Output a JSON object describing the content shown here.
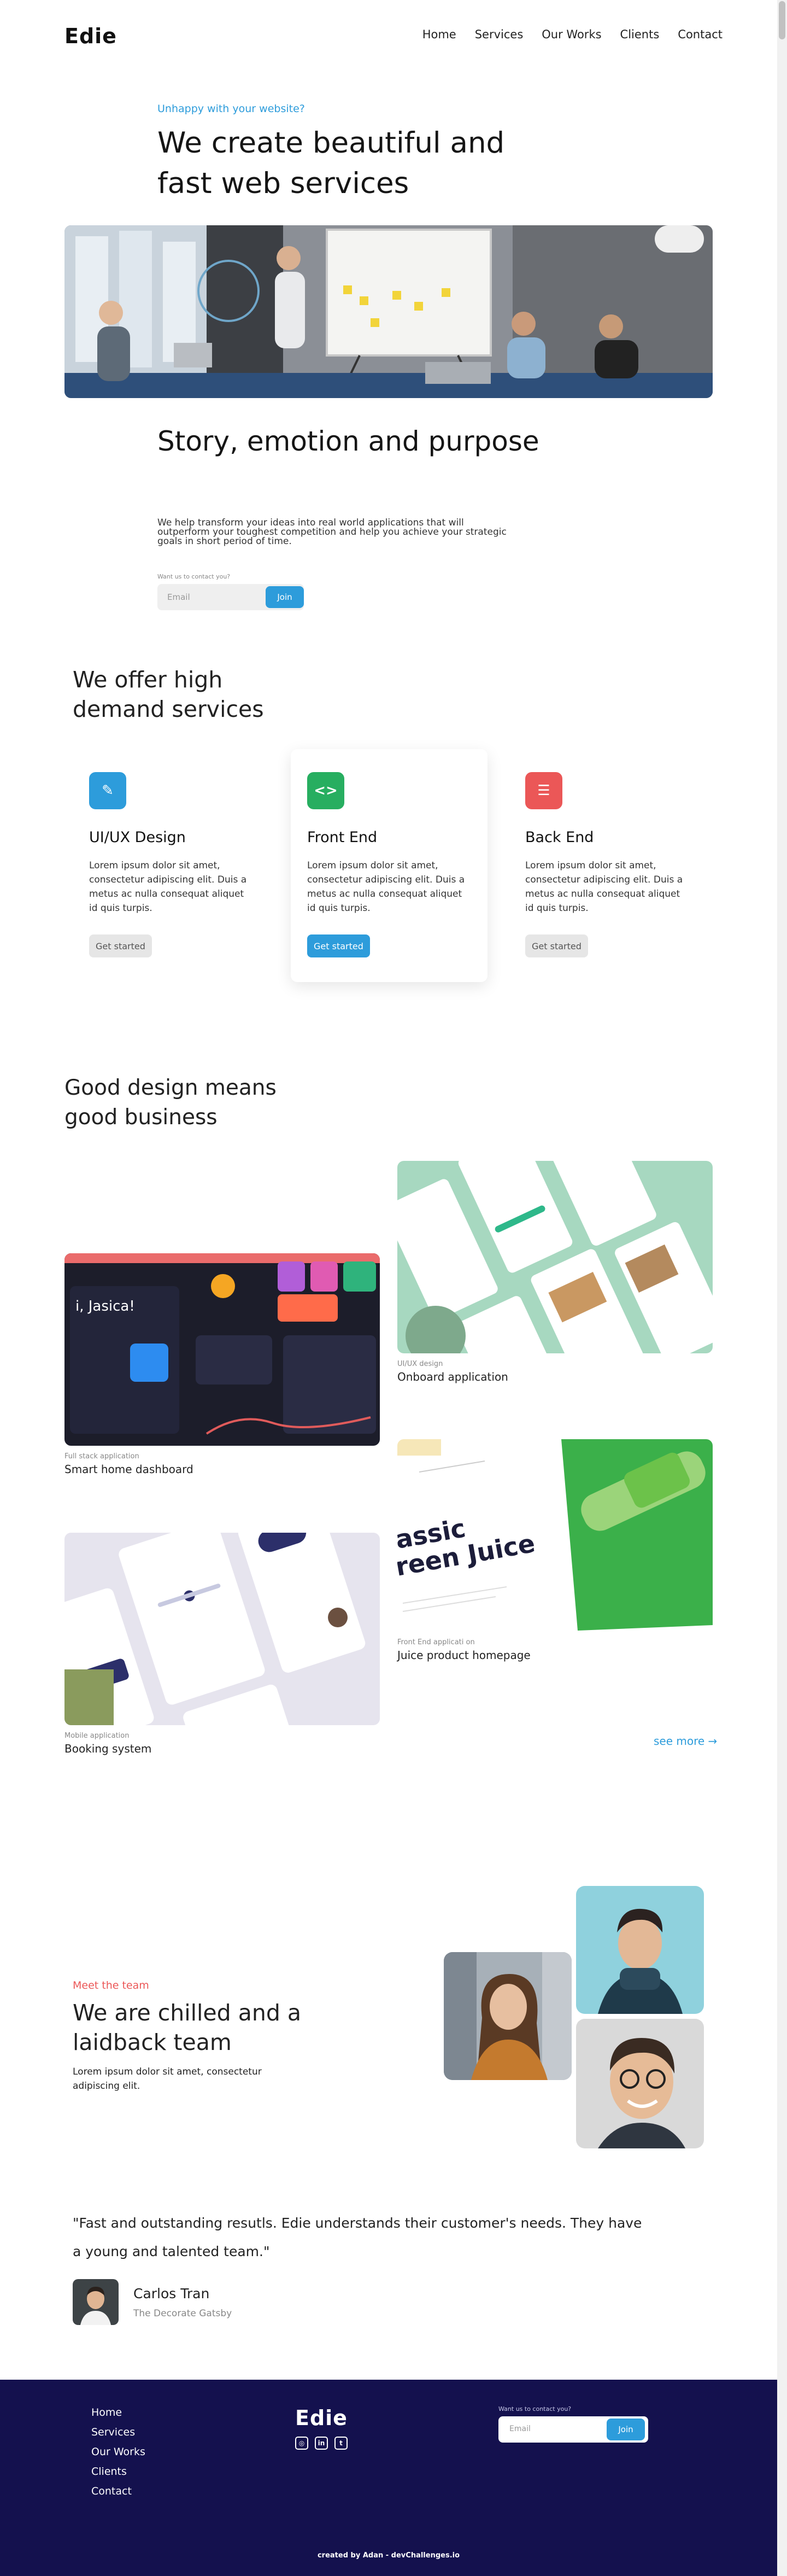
{
  "brand": "Edie",
  "nav": {
    "items": [
      "Home",
      "Services",
      "Our Works",
      "Clients",
      "Contact"
    ]
  },
  "hero": {
    "eyebrow": "Unhappy with your website?",
    "title": "We create beautiful and fast web services",
    "story_title": "Story, emotion and purpose",
    "story_text": "We help transform your ideas into real world applications that will outperform your toughest competition and help you achieve your strategic goals in short period of time.",
    "contact_label": "Want us to contact you?",
    "email_placeholder": "Email",
    "join_label": "Join"
  },
  "services": {
    "title": "We offer high demand services",
    "cards": [
      {
        "title": "UI/UX Design",
        "text": "Lorem ipsum dolor sit amet, consectetur adipiscing elit. Duis a metus ac nulla consequat aliquet id quis turpis.",
        "button": "Get started",
        "icon": "pen-icon",
        "color": "#2d9cdb"
      },
      {
        "title": "Front End",
        "text": "Lorem ipsum dolor sit amet, consectetur adipiscing elit. Duis a metus ac nulla consequat aliquet id quis turpis.",
        "button": "Get started",
        "icon": "code-icon",
        "color": "#27ae60"
      },
      {
        "title": "Back End",
        "text": "Lorem ipsum dolor sit amet, consectetur adipiscing elit. Duis a metus ac nulla consequat aliquet id quis turpis.",
        "button": "Get started",
        "icon": "list-icon",
        "color": "#eb5757"
      }
    ]
  },
  "works": {
    "title": "Good design means good business",
    "items": [
      {
        "category": "UI/UX design",
        "name": "Onboard application"
      },
      {
        "category": "Full stack application",
        "name": "Smart home dashboard"
      },
      {
        "category": "Front End applicati on",
        "name": "Juice product homepage"
      },
      {
        "category": "Mobile application",
        "name": "Booking system"
      }
    ],
    "see_more": "see more →",
    "juice_text": [
      "assic",
      "reen Juice"
    ]
  },
  "team": {
    "eyebrow": "Meet the team",
    "title": "We are chilled and a laidback team",
    "text": "Lorem ipsum dolor sit amet, consectetur adipiscing elit."
  },
  "testimonial": {
    "quote": "\"Fast and outstanding resutls. Edie understands their customer's needs. They have a young and talented team.\"",
    "name": "Carlos Tran",
    "role": "The Decorate Gatsby"
  },
  "footer": {
    "links": [
      "Home",
      "Services",
      "Our Works",
      "Clients",
      "Contact"
    ],
    "brand": "Edie",
    "contact_label": "Want us to contact you?",
    "email_placeholder": "Email",
    "join_label": "Join",
    "credit": "created by Adan - devChallenges.io"
  }
}
